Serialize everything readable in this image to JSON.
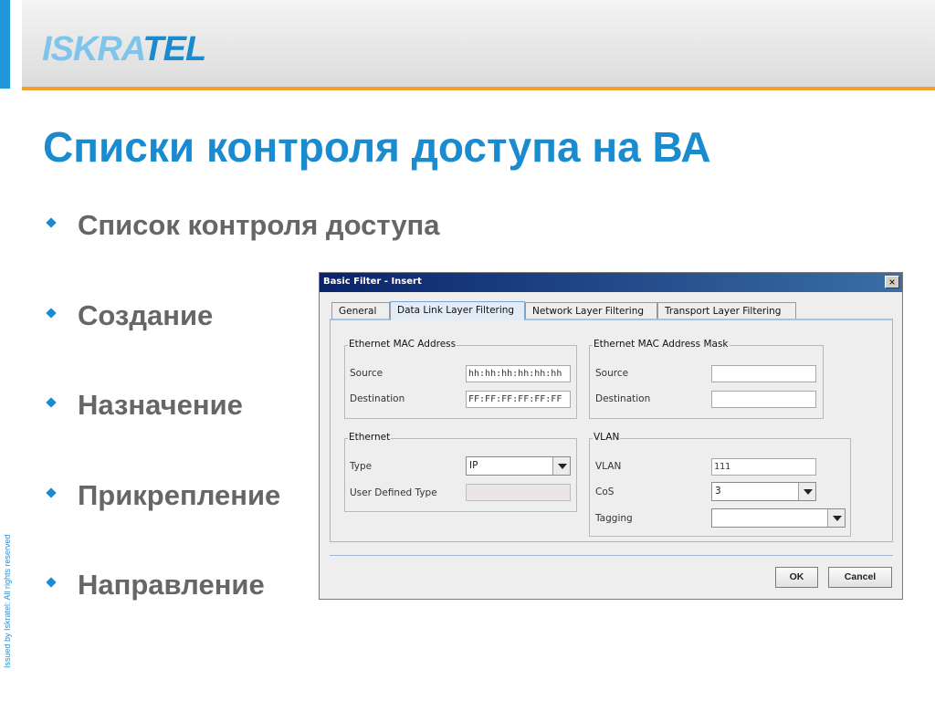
{
  "slide": {
    "logo_part1": "ISKRA",
    "logo_part2": "TEL",
    "title": "Списки контроля доступа на ВА",
    "bullets": [
      "Список контроля доступа",
      "Создание",
      "Назначение",
      "Прикрепление",
      "Направление"
    ],
    "footer_vertical": "Issued by Iskratel: All rights reserved"
  },
  "dialog": {
    "title": "Basic Filter - Insert",
    "close_glyph": "×",
    "tabs": [
      "General",
      "Data Link Layer Filtering",
      "Network Layer Filtering",
      "Transport Layer Filtering"
    ],
    "active_tab": "Data Link Layer Filtering",
    "mac": {
      "title": "Ethernet MAC Address",
      "source_label": "Source",
      "source_value": "hh:hh:hh:hh:hh:hh",
      "destination_label": "Destination",
      "destination_value": "FF:FF:FF:FF:FF:FF"
    },
    "mac_mask": {
      "title": "Ethernet MAC Address Mask",
      "source_label": "Source",
      "source_value": "",
      "destination_label": "Destination",
      "destination_value": ""
    },
    "ethernet": {
      "title": "Ethernet",
      "type_label": "Type",
      "type_value": "IP",
      "user_type_label": "User Defined Type",
      "user_type_value": ""
    },
    "vlan": {
      "title": "VLAN",
      "vlan_label": "VLAN",
      "vlan_value": "111",
      "cos_label": "CoS",
      "cos_value": "3",
      "tagging_label": "Tagging",
      "tagging_value": ""
    },
    "ok_label": "OK",
    "cancel_label": "Cancel"
  },
  "colors": {
    "brand_blue": "#1b8bd0",
    "accent_orange": "#f5a02e",
    "titlebar_dark": "#0a246a"
  }
}
